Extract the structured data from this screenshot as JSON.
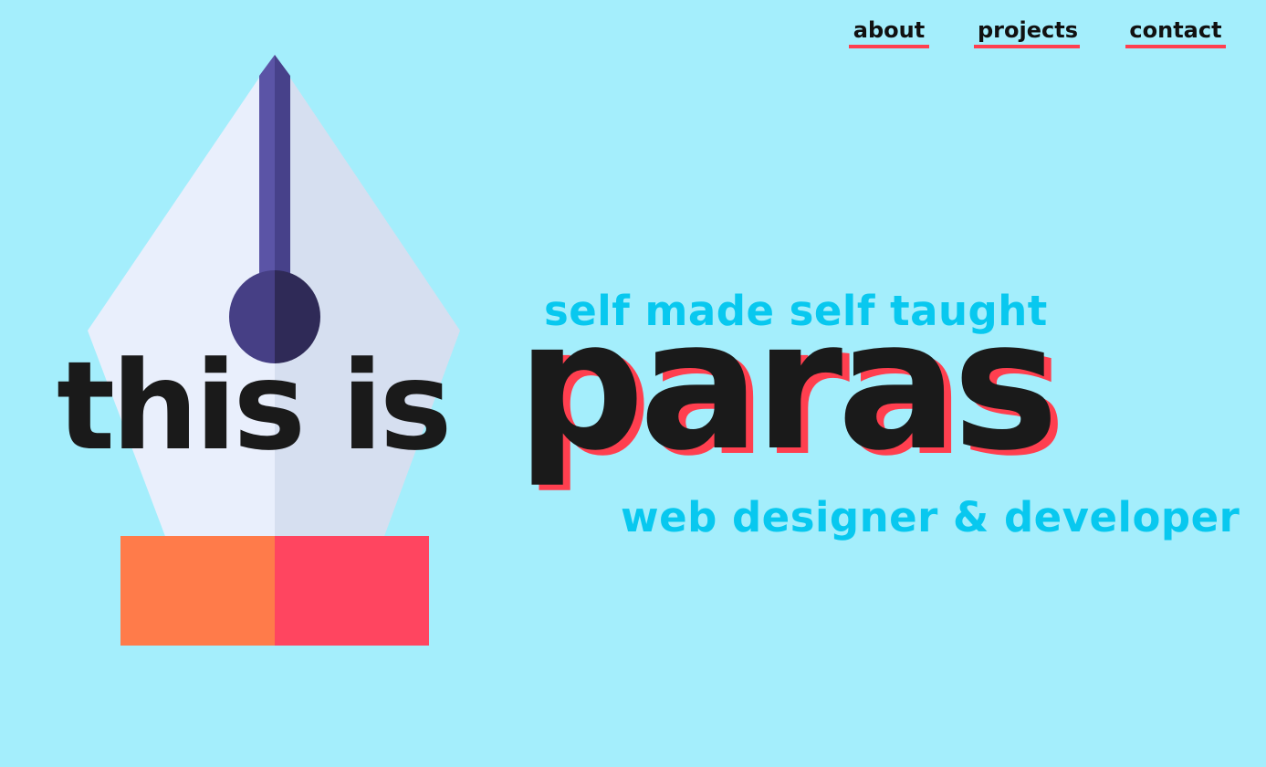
{
  "nav": {
    "items": [
      {
        "label": "about"
      },
      {
        "label": "projects"
      },
      {
        "label": "contact"
      }
    ]
  },
  "hero": {
    "tagline_top": "self made self taught",
    "intro": "this is",
    "name": "paras",
    "tagline_bottom": "web designer & developer"
  },
  "colors": {
    "background": "#a4eefc",
    "accent_red": "#ff3f4f",
    "accent_cyan": "#08c8ef",
    "text_dark": "#1a1a1a",
    "pen_body_light": "#e9effc",
    "pen_body_shade": "#d6dff0",
    "pen_stem": "#5b54a6",
    "pen_stem_dark": "#3f3a7a",
    "pen_base_orange": "#ff7b4a",
    "pen_base_red": "#ff4560"
  },
  "icons": {
    "hero_illustration": "fountain-pen-nib-icon"
  }
}
